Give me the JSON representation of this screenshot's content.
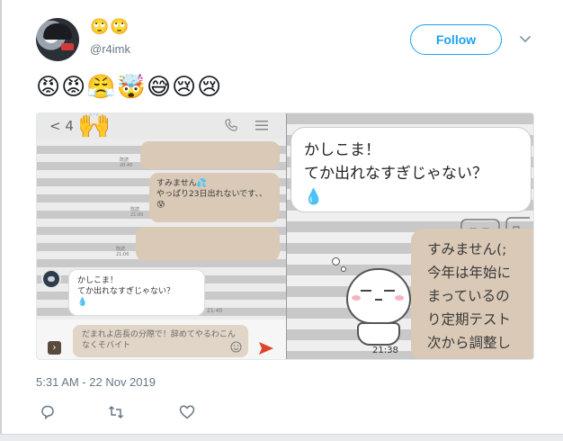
{
  "tweet": {
    "display_name_emoji": "🙄🙄",
    "handle": "@r4imk",
    "follow_label": "Follow",
    "emoji_text": "😡😡😤🤯😅😢😢",
    "timestamp": "5:31 AM - 22 Nov 2019"
  },
  "screenshot_left": {
    "back_label": "4",
    "clap_emoji": "🙌",
    "bubble_1_time": "既読 20:40",
    "bubble_2_text": "すみません💦\nやっぱり23日出れないです、、😰",
    "bubble_2_time": "既読 21:00",
    "bubble_3_time": "既読 21:06",
    "incoming_text": "かしこま！\nてか出れなすぎじゃない？\n💧",
    "incoming_time": "21:40",
    "input_text": "だまれよ店長の分際で！辞めてやるわこんなくそバイト"
  },
  "screenshot_right": {
    "bubble_text": "かしこま！\nてか出れなすぎじゃない？\n💧",
    "stamp_time": "21:38",
    "reply_text": "すみません(;\n今年は年始に\nまっているの\nり定期テスト\n次から調整し"
  },
  "colors": {
    "follow_blue": "#1da1f2",
    "meta_gray": "#657786",
    "chat_tan": "#d9c9b6",
    "send_red": "#e0452c"
  },
  "icons": [
    "chevron-down-icon",
    "phone-icon",
    "menu-icon",
    "smile-icon",
    "send-icon",
    "reply-icon",
    "retweet-icon",
    "like-icon"
  ]
}
